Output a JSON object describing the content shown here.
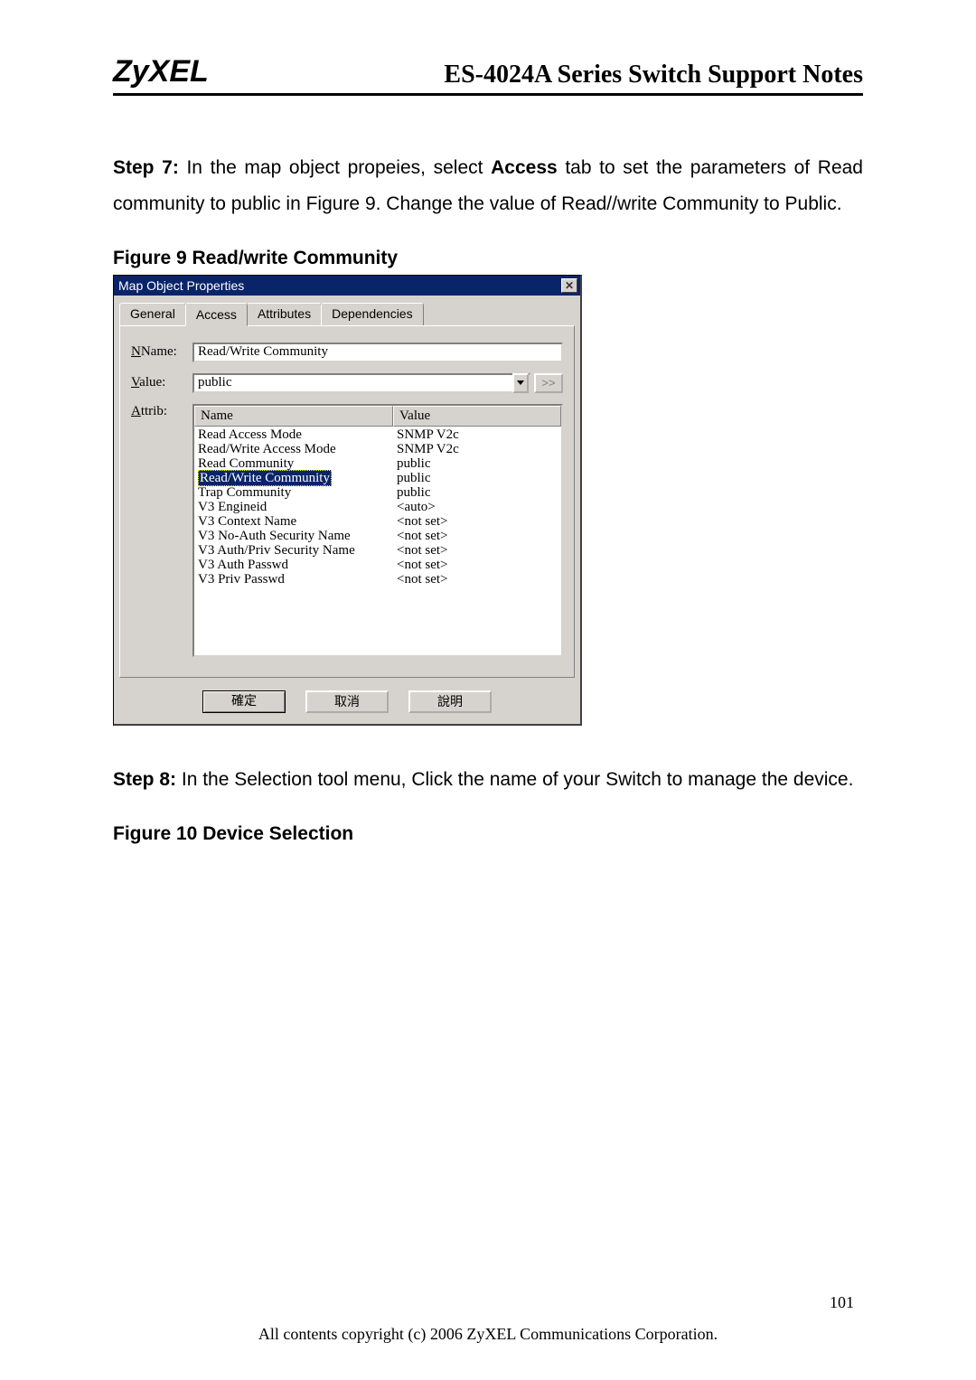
{
  "header": {
    "logo": "ZyXEL",
    "title": "ES-4024A Series Switch Support Notes"
  },
  "step7": {
    "prefix": "Step 7: ",
    "text1": "In the map object propeies, select ",
    "bold1": "Access",
    "text2": " tab to set the parameters of Read community to public in Figure 9. Change the value of Read//write Community to Public."
  },
  "figure9_caption": "Figure 9 Read/write Community",
  "dialog": {
    "title": "Map Object Properties",
    "tabs": {
      "general": "General",
      "access": "Access",
      "attributes": "Attributes",
      "dependencies": "Dependencies"
    },
    "labels": {
      "name": "Name:",
      "name_ul": "N",
      "value": "alue:",
      "value_ul": "V",
      "attrib": "ttrib:",
      "attrib_ul": "A"
    },
    "name_value": "Read/Write Community",
    "value_value": "public",
    "ext_btn": ">>",
    "columns": {
      "name": "Name",
      "value": "Value"
    },
    "rows": [
      {
        "name": "Read Access Mode",
        "value": "SNMP V2c"
      },
      {
        "name": "Read/Write Access Mode",
        "value": "SNMP V2c"
      },
      {
        "name": "Read Community",
        "value": "public"
      },
      {
        "name": "Read/Write Community",
        "value": "public",
        "selected": true
      },
      {
        "name": "Trap Community",
        "value": "public"
      },
      {
        "name": "V3 Engineid",
        "value": "<auto>"
      },
      {
        "name": "V3 Context Name",
        "value": "<not set>"
      },
      {
        "name": "V3 No-Auth Security Name",
        "value": "<not set>"
      },
      {
        "name": "V3 Auth/Priv Security Name",
        "value": "<not set>"
      },
      {
        "name": "V3 Auth Passwd",
        "value": "<not set>"
      },
      {
        "name": "V3 Priv Passwd",
        "value": "<not set>"
      }
    ],
    "buttons": {
      "ok": "確定",
      "cancel": "取消",
      "help": "說明"
    }
  },
  "step8": {
    "prefix": "Step 8: ",
    "text": "In the Selection tool menu, Click the name of your Switch to manage the device."
  },
  "figure10_caption": "Figure 10 Device Selection",
  "page_number": "101",
  "footer": "All contents copyright (c) 2006 ZyXEL Communications Corporation."
}
